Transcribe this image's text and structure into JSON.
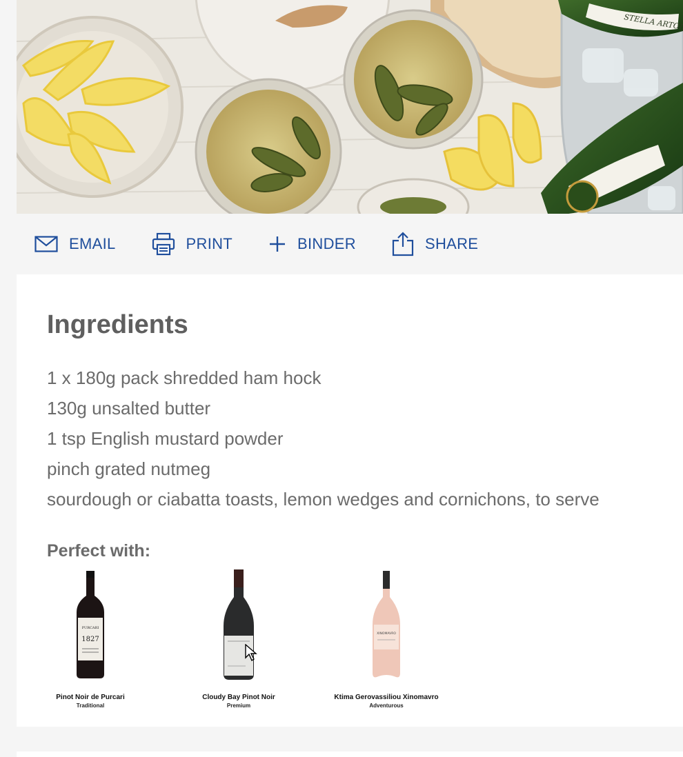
{
  "actions": {
    "email": "EMAIL",
    "print": "PRINT",
    "binder": "BINDER",
    "share": "SHARE"
  },
  "ingredients": {
    "heading": "Ingredients",
    "items": [
      "1 x 180g pack shredded ham hock",
      "130g unsalted butter",
      "1 tsp English mustard powder",
      "pinch grated nutmeg",
      "sourdough or ciabatta toasts, lemon wedges and cornichons, to serve"
    ]
  },
  "pairing": {
    "heading": "Perfect with:",
    "wines": [
      {
        "name": "Pinot Noir de Purcari",
        "tag": "Traditional"
      },
      {
        "name": "Cloudy Bay Pinot Noir",
        "tag": "Premium"
      },
      {
        "name": "Ktima Gerovassiliou Xinomavro",
        "tag": "Adventurous"
      }
    ],
    "bottle_labels": {
      "purcari": "PURCARI",
      "purcari_year": "1827",
      "xinomavro": "XINOMAVRO"
    }
  },
  "hero": {
    "bottle_label": "STELLA ARTOIS"
  },
  "colors": {
    "accent": "#1f4e9c",
    "heading": "#5f5f5f",
    "body_text": "#6b6b6b",
    "page_bg": "#f5f5f5"
  },
  "icons": {
    "email": "envelope-icon",
    "print": "printer-icon",
    "binder": "plus-icon",
    "share": "share-icon"
  }
}
